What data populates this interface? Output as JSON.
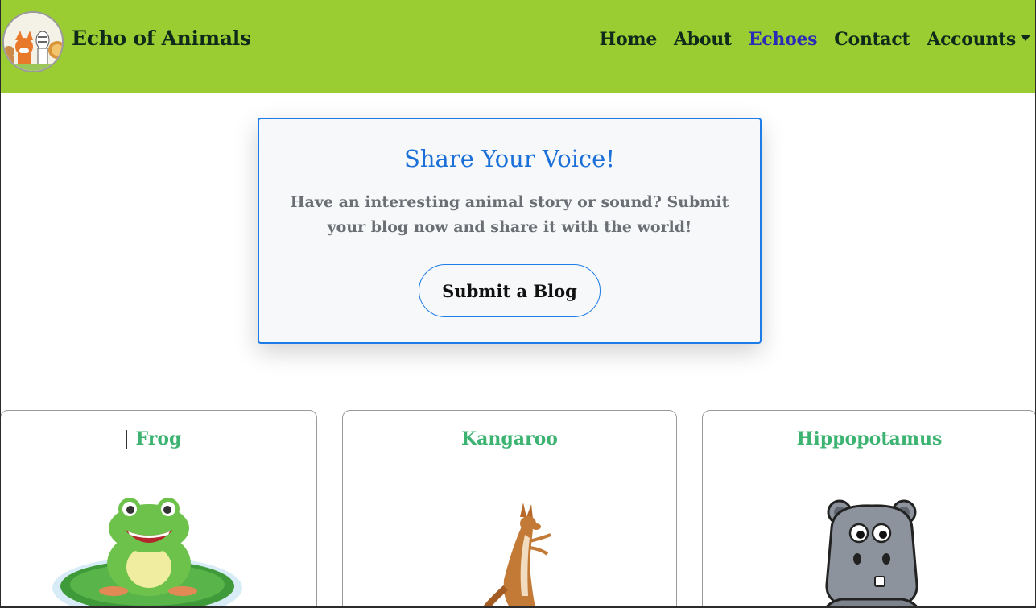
{
  "brand": {
    "name": "Echo of Animals",
    "logo_icon": "animals-logo-icon"
  },
  "nav": {
    "items": [
      {
        "label": "Home",
        "active": false
      },
      {
        "label": "About",
        "active": false
      },
      {
        "label": "Echoes",
        "active": true
      },
      {
        "label": "Contact",
        "active": false
      },
      {
        "label": "Accounts",
        "active": false,
        "dropdown": true
      }
    ]
  },
  "share": {
    "title": "Share Your Voice!",
    "text_line1": "Have an interesting animal story or sound? Submit",
    "text_line2": "your blog now and share it with the world!",
    "button_label": "Submit a Blog"
  },
  "animals": [
    {
      "name": "Frog",
      "icon": "frog-icon"
    },
    {
      "name": "Kangaroo",
      "icon": "kangaroo-icon"
    },
    {
      "name": "Hippopotamus",
      "icon": "hippopotamus-icon"
    }
  ],
  "colors": {
    "navbar_bg": "#9acd32",
    "nav_text": "#0f2a1a",
    "nav_active": "#2b2bb8",
    "accent_blue": "#1e7ce8",
    "animal_title": "#3cb371"
  }
}
